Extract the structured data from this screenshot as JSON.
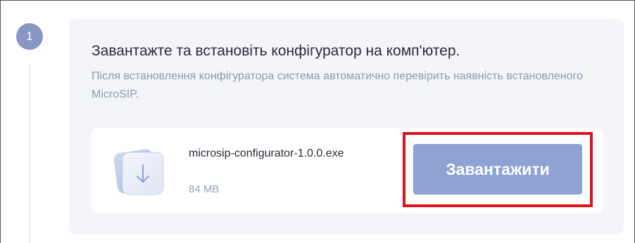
{
  "step": {
    "number": "1"
  },
  "content": {
    "title": "Завантажте та встановіть конфігуратор на комп'ютер.",
    "description": "Після встановлення конфігуратора система автоматично перевірить наявність встановленого MicroSIP."
  },
  "file": {
    "icon": "download-file-icon",
    "name": "microsip-configurator-1.0.0.exe",
    "size": "84 MB"
  },
  "download": {
    "label": "Завантажити"
  },
  "colors": {
    "accent": "#8fa2d4",
    "badge": "#8796c4",
    "highlight": "#e0111b"
  }
}
